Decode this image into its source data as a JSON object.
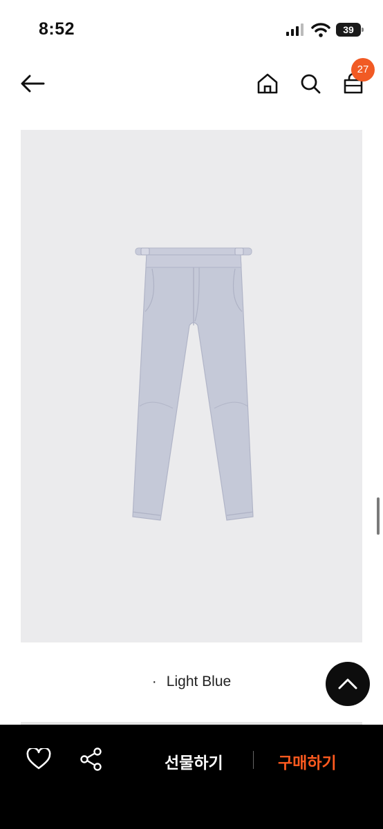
{
  "status_bar": {
    "time": "8:52",
    "battery": "39"
  },
  "nav": {
    "cart_count": "27"
  },
  "product": {
    "color_option": "Light Blue",
    "bullet": "·"
  },
  "bottom_bar": {
    "gift_label": "선물하기",
    "buy_label": "구매하기"
  },
  "colors": {
    "accent": "#f15a24",
    "buy_text": "#ff5a1f",
    "image_bg": "#ebebed",
    "pants": "#c5c9d8"
  }
}
